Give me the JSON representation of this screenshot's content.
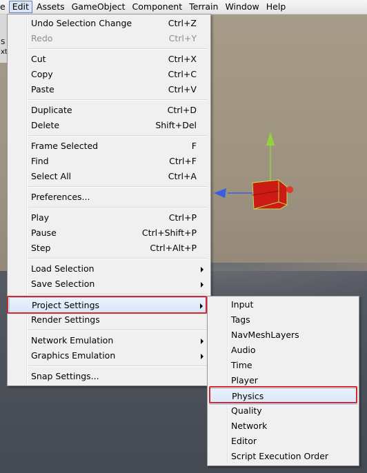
{
  "menubar": {
    "items": [
      "e",
      "Edit",
      "Assets",
      "GameObject",
      "Component",
      "Terrain",
      "Window",
      "Help"
    ]
  },
  "left_panel": {
    "chars": [
      "S",
      "xt"
    ]
  },
  "edit_menu": {
    "items": [
      {
        "label": "Undo Selection Change",
        "shortcut": "Ctrl+Z"
      },
      {
        "label": "Redo",
        "shortcut": "Ctrl+Y",
        "disabled": true
      },
      {
        "label": "Cut",
        "shortcut": "Ctrl+X"
      },
      {
        "label": "Copy",
        "shortcut": "Ctrl+C"
      },
      {
        "label": "Paste",
        "shortcut": "Ctrl+V"
      },
      {
        "label": "Duplicate",
        "shortcut": "Ctrl+D"
      },
      {
        "label": "Delete",
        "shortcut": "Shift+Del"
      },
      {
        "label": "Frame Selected",
        "shortcut": "F"
      },
      {
        "label": "Find",
        "shortcut": "Ctrl+F"
      },
      {
        "label": "Select All",
        "shortcut": "Ctrl+A"
      },
      {
        "label": "Preferences..."
      },
      {
        "label": "Play",
        "shortcut": "Ctrl+P"
      },
      {
        "label": "Pause",
        "shortcut": "Ctrl+Shift+P"
      },
      {
        "label": "Step",
        "shortcut": "Ctrl+Alt+P"
      },
      {
        "label": "Load Selection",
        "submenu": true
      },
      {
        "label": "Save Selection",
        "submenu": true
      },
      {
        "label": "Project Settings",
        "submenu": true,
        "highlighted": true
      },
      {
        "label": "Render Settings"
      },
      {
        "label": "Network Emulation",
        "submenu": true
      },
      {
        "label": "Graphics Emulation",
        "submenu": true
      },
      {
        "label": "Snap Settings..."
      }
    ]
  },
  "project_settings_menu": {
    "items": [
      {
        "label": "Input"
      },
      {
        "label": "Tags"
      },
      {
        "label": "NavMeshLayers"
      },
      {
        "label": "Audio"
      },
      {
        "label": "Time"
      },
      {
        "label": "Player"
      },
      {
        "label": "Physics",
        "highlighted": true
      },
      {
        "label": "Quality"
      },
      {
        "label": "Network"
      },
      {
        "label": "Editor"
      },
      {
        "label": "Script Execution Order"
      }
    ]
  },
  "colors": {
    "highlight_box": "#d4272d",
    "gizmo_y": "#8fd43a",
    "gizmo_x": "#e03a2c",
    "gizmo_z": "#3a5ee0",
    "cube": "#cc1a14"
  }
}
